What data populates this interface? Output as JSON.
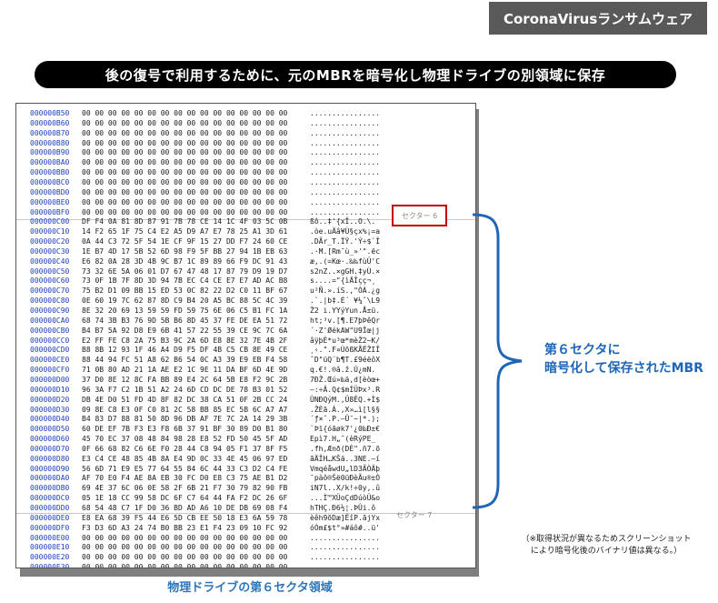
{
  "tag": "CoronaVirusランサムウェア",
  "banner": "後の復号で利用するために、元のMBRを暗号化し物理ドライブの別領域に保存",
  "hex_view": {
    "sector_label_6": "セクター 6",
    "sector_label_7": "セクター 7",
    "rows": [
      {
        "addr": "000000B50",
        "bytes": "00 00 00 00 00 00 00 00 00 00 00 00 00 00 00 00",
        "ascii": "................"
      },
      {
        "addr": "000000B60",
        "bytes": "00 00 00 00 00 00 00 00 00 00 00 00 00 00 00 00",
        "ascii": "................"
      },
      {
        "addr": "000000B70",
        "bytes": "00 00 00 00 00 00 00 00 00 00 00 00 00 00 00 00",
        "ascii": "................"
      },
      {
        "addr": "000000B80",
        "bytes": "00 00 00 00 00 00 00 00 00 00 00 00 00 00 00 00",
        "ascii": "................"
      },
      {
        "addr": "000000B90",
        "bytes": "00 00 00 00 00 00 00 00 00 00 00 00 00 00 00 00",
        "ascii": "................"
      },
      {
        "addr": "000000BA0",
        "bytes": "00 00 00 00 00 00 00 00 00 00 00 00 00 00 00 00",
        "ascii": "................"
      },
      {
        "addr": "000000BB0",
        "bytes": "00 00 00 00 00 00 00 00 00 00 00 00 00 00 00 00",
        "ascii": "................"
      },
      {
        "addr": "000000BC0",
        "bytes": "00 00 00 00 00 00 00 00 00 00 00 00 00 00 00 00",
        "ascii": "................"
      },
      {
        "addr": "000000BD0",
        "bytes": "00 00 00 00 00 00 00 00 00 00 00 00 00 00 00 00",
        "ascii": "................"
      },
      {
        "addr": "000000BE0",
        "bytes": "00 00 00 00 00 00 00 00 00 00 00 00 00 00 00 00",
        "ascii": "................"
      },
      {
        "addr": "000000BF0",
        "bytes": "00 00 00 00 00 00 00 00 00 00 00 00 00 00 00 00",
        "ascii": "................"
      },
      {
        "addr": "000000C00",
        "bytes": "DF F4 0A 81 8D 87 91 7B 78 CE 14 1C 4F 03 5C 0B",
        "ascii": "ßô..‡'{xÎ..O.\\."
      },
      {
        "addr": "000000C10",
        "bytes": "14 F2 65 1F 75 C4 E2 A5 D9 A7 E7 78 25 A1 3D 61",
        "ascii": ".òe.uÄâ¥Ù§çx%¡=a"
      },
      {
        "addr": "000000C20",
        "bytes": "0A 44 C3 72 5F 54 1E CF 9F 15 27 DD F7 24 60 CE",
        "ascii": ".DÃr_T.ÏŸ.'Ý÷$`Î"
      },
      {
        "addr": "000000C30",
        "bytes": "1E B7 4D 17 5B 52 6D 98 F9 5F BB 27 94 1B EB 63",
        "ascii": ".·M.[Rm˜ù_»'\".ëc"
      },
      {
        "addr": "000000C40",
        "bytes": "E6 82 0A 28 3D 4B 9C B7 1C 89 89 66 F9 DC 91 43",
        "ascii": "æ‚.(=Kœ·.‰‰fùÜ'C"
      },
      {
        "addr": "000000C50",
        "bytes": "73 32 6E 5A 06 01 D7 67 47 48 17 87 79 D9 19 D7",
        "ascii": "s2nZ..×gGH.‡yÙ.×"
      },
      {
        "addr": "000000C60",
        "bytes": "73 0F 1B 7F 8D 3D 94 7B EC C4 CE E7 E7 AD AC B8",
        "ascii": "s....=\"{ìÄÎçç­¬¸"
      },
      {
        "addr": "000000C70",
        "bytes": "75 B2 D1 09 BB 15 ED 53 0C 82 22 D2 C0 11 BF 67",
        "ascii": "u²Ñ.».íS.‚\"ÒÀ.¿g"
      },
      {
        "addr": "000000C80",
        "bytes": "0E 60 19 7C 62 87 8D C9 B4 20 A5 BC 88 5C 4C 39",
        "ascii": ".`.|b‡.É´ ¥¼ˆ\\L9"
      },
      {
        "addr": "000000C90",
        "bytes": "8E 32 20 69 13 59 59 FD 59 75 6E 06 C5 B1 FC 1A",
        "ascii": "Ž2 i.YYýYun.Å±ü."
      },
      {
        "addr": "000000CA0",
        "bytes": "68 74 3B B3 76 9D 5B B6 8D 45 37 FE DE EA 51 72",
        "ascii": "ht;³v.[¶.E7þÞêQr"
      },
      {
        "addr": "000000CB0",
        "bytes": "B4 B7 5A 92 D8 E9 6B 41 57 22 55 39 CE 9C 7C 6A",
        "ascii": "´·Z'ØékAW\"U9Îœ|j"
      },
      {
        "addr": "000000CC0",
        "bytes": "E2 FF FE C8 2A 75 B3 9C 2A 6D E8 8E 32 7E 4B 2F",
        "ascii": "âÿþÈ*u³œ*mèŽ2~K/"
      },
      {
        "addr": "000000CD0",
        "bytes": "B8 8B 12 93 1F 46 A4 D9 F5 DF 4B C5 CB 8E 49 CE",
        "ascii": "¸‹.\".F¤ÙõßKÅËŽIÎ"
      },
      {
        "addr": "000000CE0",
        "bytes": "88 44 94 FC 51 A8 62 B6 54 0C A3 39 E9 EB F4 58",
        "ascii": "ˆD\"üQ¨b¶T.£9éëôX"
      },
      {
        "addr": "000000CF0",
        "bytes": "71 0B 80 AD 21 1A AE E2 1C 9E 11 DA BF 6D 4E 9D",
        "ascii": "q.€­!.®â.ž.Ú¿mN."
      },
      {
        "addr": "000000D00",
        "bytes": "37 D0 8E 12 8C FA BB 89 E4 2C 64 5B E8 F2 9C 2B",
        "ascii": "7ÐŽ.Œú»‰ä,d[èòœ+"
      },
      {
        "addr": "000000D10",
        "bytes": "96 3A F7 C2 1B 51 A2 24 6D CD DC DE 78 B3 01 52",
        "ascii": "–:÷Â.Q¢$mÍÜÞx³.R"
      },
      {
        "addr": "000000D20",
        "bytes": "DB 4E D0 51 FD 4D 8F 82 DC 38 CA 51 0F 2B CC 24",
        "ascii": "ÛNÐQýM.‚Ü8ÊQ.+Ì$"
      },
      {
        "addr": "000000D30",
        "bytes": "09 8E C8 E3 0F C0 81 2C 58 BB 85 EC 5B 6C A7 A7",
        "ascii": ".ŽÈã.À.,X»…ì[l§§"
      },
      {
        "addr": "000000D40",
        "bytes": "B4 83 D7 88 81 50 8D 96 DB AF 7E 7C 2A 14 29 3B",
        "ascii": "´ƒ×ˆ.P.–Û¯~|*.);"
      },
      {
        "addr": "000000D50",
        "bytes": "60 DE EF 7B F3 E3 F8 6B 37 91 BF 30 89 D0 B1 80",
        "ascii": "`Þï{óãøk7'¿0‰Ð±€"
      },
      {
        "addr": "000000D60",
        "bytes": "45 70 EC 37 08 48 84 98 28 E8 52 FD 50 45 5F AD",
        "ascii": "Epì7.H„˜(èRýPE_­"
      },
      {
        "addr": "000000D70",
        "bytes": "0F 66 68 82 C6 6E F0 28 44 C8 94 05 F1 37 8F F5",
        "ascii": ".fh‚Ænð(DÈ\".ñ7.õ"
      },
      {
        "addr": "000000D80",
        "bytes": "E3 C4 CE 48 85 4B 8A E4 9D 0C 33 4E 45 06 97 ED",
        "ascii": "ãÄÎH…KŠä..3NE.—í"
      },
      {
        "addr": "000000D90",
        "bytes": "56 6D 71 E9 E5 77 64 55 84 6C 44 33 C3 D2 C4 FE",
        "ascii": "VmqéåwdU„lD3ÃÒÄþ"
      },
      {
        "addr": "000000DA0",
        "bytes": "AF 70 E0 F4 AE 8A EB 30 FC D0 E8 C3 75 AE B1 D2",
        "ascii": "¯pàô®Šë0üÐèÃu®±Ò"
      },
      {
        "addr": "000000DB0",
        "bytes": "69 4E 37 6C 06 0E 58 2F 6B 21 F7 30 79 82 90 FB",
        "ascii": "iN7l..X/k!÷0y‚.û"
      },
      {
        "addr": "000000DC0",
        "bytes": "05 1E 18 CC 99 58 DC 6F C7 64 44 FA F2 DC 26 6F",
        "ascii": "...Ì™XÜoÇdDúòÜ&o"
      },
      {
        "addr": "000000DD0",
        "bytes": "68 54 48 C7 1F D0 36 BD AD A6 10 DE DB 69 08 F4",
        "ascii": "hTHÇ.Ð6½­¦.ÞÛi.ô"
      },
      {
        "addr": "000000DE0",
        "bytes": "E8 EA 68 39 F5 44 E6 5D CB EE 50 18 E3 6A 59 78",
        "ascii": "èêh9õDæ]ËîP.ãjYx"
      },
      {
        "addr": "000000DF0",
        "bytes": "F3 D3 6D A3 24 74 B0 BB 23 E1 F4 23 09 10 FC 92",
        "ascii": "óÓm£$t°»#áô#..ü'"
      },
      {
        "addr": "000000E00",
        "bytes": "00 00 00 00 00 00 00 00 00 00 00 00 00 00 00 00",
        "ascii": "................"
      },
      {
        "addr": "000000E10",
        "bytes": "00 00 00 00 00 00 00 00 00 00 00 00 00 00 00 00",
        "ascii": "................"
      },
      {
        "addr": "000000E20",
        "bytes": "00 00 00 00 00 00 00 00 00 00 00 00 00 00 00 00",
        "ascii": "................"
      },
      {
        "addr": "000000E30",
        "bytes": "00 00 00 00 00 00 00 00 00 00 00 00 00 00 00 00",
        "ascii": "................"
      },
      {
        "addr": "000000E40",
        "bytes": "00 00 00 00 00 00 00 00 00 00 00 00 00 00 00 00",
        "ascii": "................"
      }
    ]
  },
  "caption": "物理ドライブの第６セクタ領域",
  "callout": {
    "line1": "第６セクタに",
    "line2": "暗号化して保存されたMBR"
  },
  "note": {
    "line1": "（※取得状況が異なるためスクリーンショット",
    "line2": "により暗号化後のバイナリ値は異なる。）"
  },
  "colors": {
    "banner_bg": "#000000",
    "tag_bg": "#595959",
    "accent_blue": "#1f66b6",
    "address_blue": "#1f3fbf",
    "highlight_red": "#c00000"
  }
}
